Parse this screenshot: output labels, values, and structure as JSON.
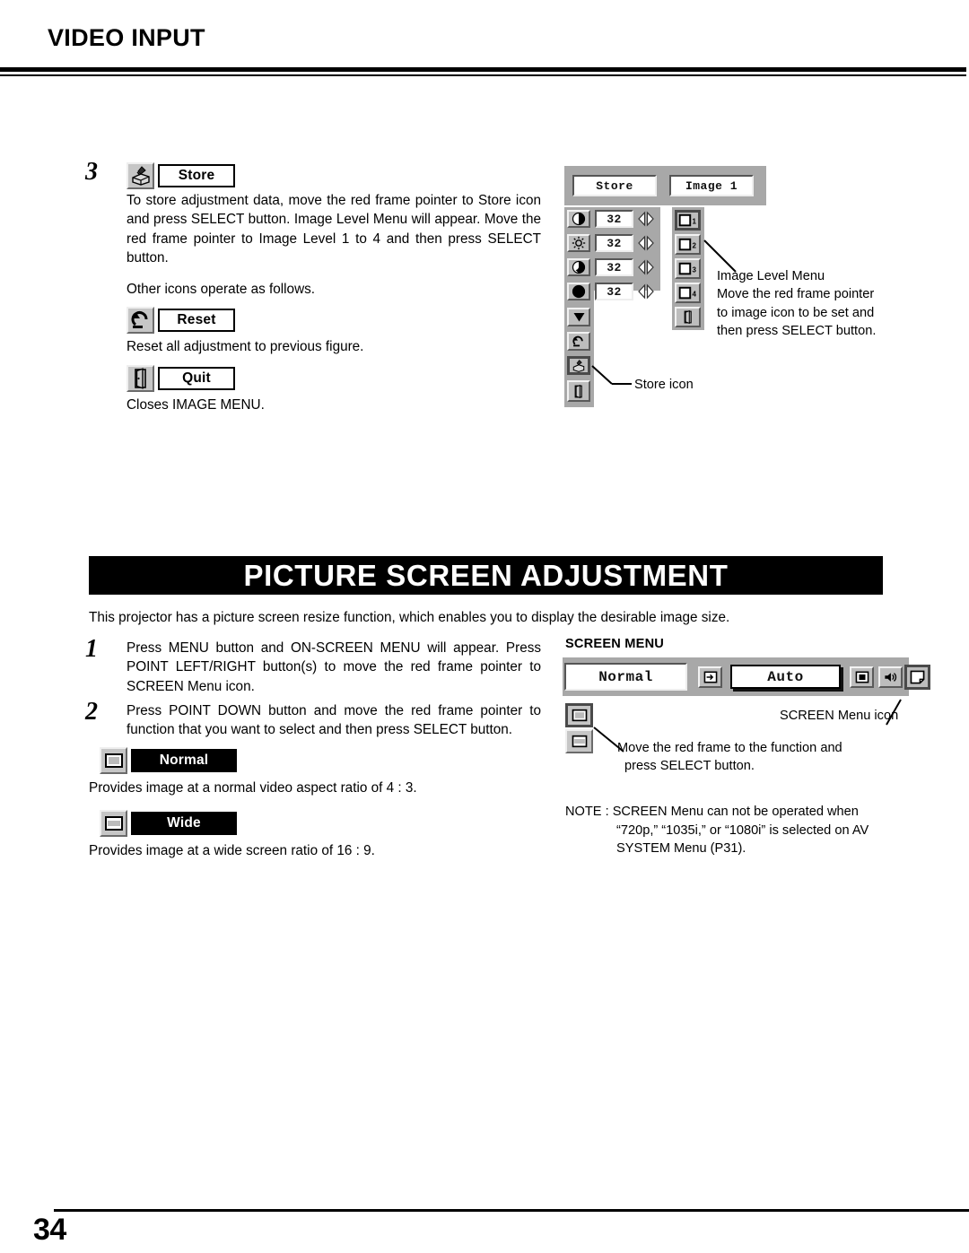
{
  "header": {
    "title": "VIDEO INPUT"
  },
  "step3": {
    "number": "3",
    "store_label": "Store",
    "store_icon": "store-icon",
    "paragraph": "To store adjustment data, move the red frame pointer to Store icon and press SELECT button.  Image Level Menu will appear. Move the red frame pointer to Image Level 1 to 4 and then press SELECT button.",
    "other_icons_line": "Other icons operate as follows.",
    "reset_label": "Reset",
    "reset_icon": "reset-arrow-icon",
    "reset_desc": "Reset all adjustment to previous figure.",
    "quit_label": "Quit",
    "quit_icon": "door-exit-icon",
    "quit_desc": "Closes IMAGE MENU."
  },
  "image_menu_osd": {
    "store_button": "Store",
    "image_button": "Image 1",
    "values": [
      "32",
      "32",
      "32",
      "32"
    ],
    "adjust_icons": [
      "contrast-icon",
      "brightness-icon",
      "color-icon",
      "tint-icon"
    ],
    "left_column_icons": [
      "down-arrow-icon",
      "reset-arrow-icon",
      "store-icon",
      "door-exit-icon"
    ],
    "level_icons": [
      "image-level-1-icon",
      "image-level-2-icon",
      "image-level-3-icon",
      "image-level-4-icon",
      "door-exit-icon"
    ],
    "level_numbers": [
      "1",
      "2",
      "3",
      "4"
    ],
    "callout_level_menu": [
      "Image Level Menu",
      "Move the red frame pointer",
      "to  image icon to be set and",
      "then press SELECT button."
    ],
    "callout_store_icon": "Store icon"
  },
  "banner": {
    "title": "PICTURE SCREEN ADJUSTMENT"
  },
  "intro": {
    "text": "This projector has a picture screen resize function, which enables you to display the desirable image size."
  },
  "step1": {
    "number": "1",
    "paragraph": "Press MENU button and ON-SCREEN MENU will appear.  Press POINT LEFT/RIGHT button(s) to move the red frame pointer to SCREEN Menu icon."
  },
  "step2": {
    "number": "2",
    "paragraph": "Press POINT DOWN button and move the red frame pointer to function that you want to select and then press SELECT button."
  },
  "screen_options": {
    "normal_label": "Normal",
    "normal_icon": "normal-screen-icon",
    "normal_desc": "Provides image at a normal video aspect ratio of 4 : 3.",
    "wide_label": "Wide",
    "wide_icon": "wide-screen-icon",
    "wide_desc": "Provides image at a wide screen ratio of 16 : 9."
  },
  "screen_menu": {
    "heading": "SCREEN MENU",
    "normal_field": "Normal",
    "auto_field": "Auto",
    "toolbar_icons": [
      "input-icon",
      "pip-icon",
      "sound-icon",
      "screen-icon"
    ],
    "screen_menu_icon_callout": "SCREEN Menu icon",
    "frame_callout": [
      "Move the red frame to the function and",
      "press SELECT button."
    ],
    "option_icons": [
      "normal-screen-icon",
      "wide-screen-icon"
    ]
  },
  "note": {
    "lines": [
      "NOTE : SCREEN Menu can not be operated when",
      "“720p,” “1035i,” or “1080i” is selected on AV",
      "SYSTEM Menu (P31)."
    ]
  },
  "footer": {
    "page_number": "34"
  },
  "colors": {
    "banner_bg": "#000000",
    "osd_bg": "#a8a8a8",
    "icon_face": "#c6c6c6"
  }
}
